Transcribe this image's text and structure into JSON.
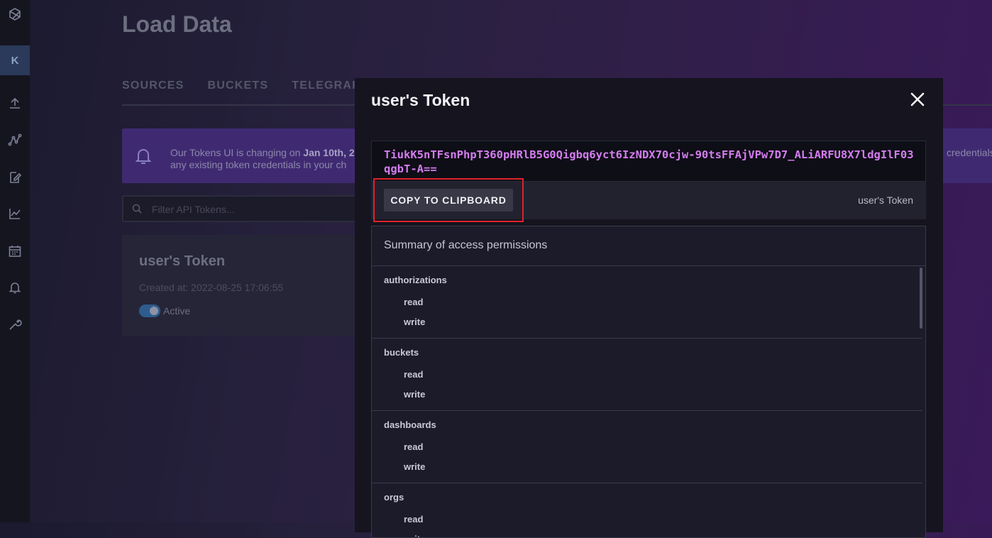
{
  "nav": {
    "org_initial": "K",
    "icons": [
      "logo-icon",
      "upload-icon",
      "graph-icon",
      "edit-icon",
      "chart-icon",
      "calendar-icon",
      "bell-icon",
      "wrench-icon"
    ]
  },
  "page": {
    "title": "Load Data",
    "tabs": [
      "SOURCES",
      "BUCKETS",
      "TELEGRAF"
    ],
    "notice_line1_prefix": "Our Tokens UI is changing on ",
    "notice_line1_bold": "Jan 10th, 2",
    "notice_line2": "any existing token credentials in your ch",
    "notice_right": "credentials",
    "filter_placeholder": "Filter API Tokens...",
    "token_card": {
      "name": "user's Token",
      "created": "Created at: 2022-08-25 17:06:55",
      "status": "Active"
    }
  },
  "modal": {
    "title": "user's Token",
    "token": "TiukK5nTFsnPhpT360pHRlB5G0Qigbq6yct6IzNDX70cjw-90tsFFAjVPw7D7_ALiARFU8X7ldgIlF03qgbT-A==",
    "copy_label": "COPY TO CLIPBOARD",
    "token_description": "user's Token",
    "summary_title": "Summary of access permissions",
    "permissions": [
      {
        "resource": "authorizations",
        "actions": [
          "read",
          "write"
        ]
      },
      {
        "resource": "buckets",
        "actions": [
          "read",
          "write"
        ]
      },
      {
        "resource": "dashboards",
        "actions": [
          "read",
          "write"
        ]
      },
      {
        "resource": "orgs",
        "actions": [
          "read",
          "write"
        ]
      }
    ]
  },
  "colors": {
    "accent_highlight": "#e0222a",
    "token_text": "#d47df0",
    "notice_bg": "#3f2a72"
  }
}
